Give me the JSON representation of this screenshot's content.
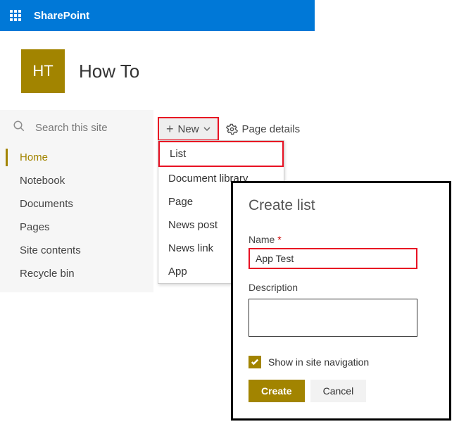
{
  "banner": {
    "brand": "SharePoint"
  },
  "site": {
    "logo_text": "HT",
    "title": "How To"
  },
  "search": {
    "placeholder": "Search this site"
  },
  "nav": {
    "items": [
      {
        "label": "Home",
        "active": true
      },
      {
        "label": "Notebook"
      },
      {
        "label": "Documents"
      },
      {
        "label": "Pages"
      },
      {
        "label": "Site contents"
      },
      {
        "label": "Recycle bin"
      }
    ]
  },
  "toolbar": {
    "new_label": "New",
    "page_details_label": "Page details"
  },
  "dropdown": {
    "items": [
      {
        "label": "List",
        "hl": true
      },
      {
        "label": "Document library"
      },
      {
        "label": "Page"
      },
      {
        "label": "News post"
      },
      {
        "label": "News link"
      },
      {
        "label": "App"
      }
    ]
  },
  "panel": {
    "title": "Create list",
    "name_label": "Name",
    "name_value": "App Test",
    "desc_label": "Description",
    "show_nav_label": "Show in site navigation",
    "show_nav_checked": true,
    "create_label": "Create",
    "cancel_label": "Cancel"
  },
  "colors": {
    "accent": "#a28400",
    "brand": "#0078d7",
    "highlight": "#e81123"
  }
}
